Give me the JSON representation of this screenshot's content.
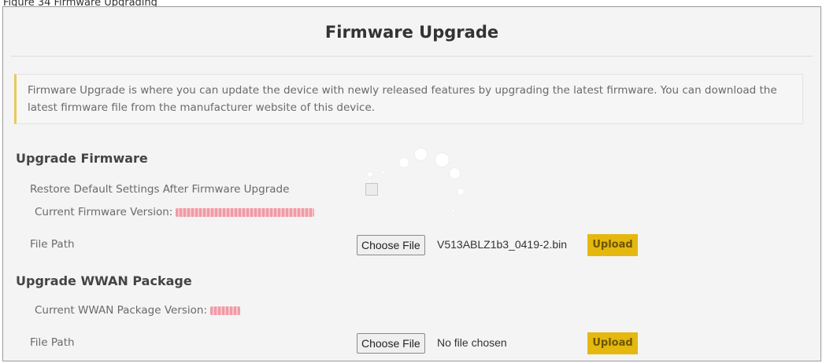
{
  "caption": "Figure 34   Firmware Upgrading",
  "page": {
    "title": "Firmware Upgrade",
    "description": "Firmware Upgrade is where you can update the device with newly released features by upgrading the latest firmware. You can download the latest firmware file from the manufacturer website of this device."
  },
  "upgrade_firmware": {
    "heading": "Upgrade Firmware",
    "restore_label": "Restore Default Settings After Firmware Upgrade",
    "restore_checked": false,
    "version_label": "Current Firmware Version:",
    "file_path_label": "File Path",
    "choose_file_label": "Choose File",
    "file_name": "V513ABLZ1b3_0419-2.bin",
    "upload_label": "Upload"
  },
  "upgrade_wwan": {
    "heading": "Upgrade WWAN Package",
    "version_label": "Current WWAN Package Version:",
    "file_path_label": "File Path",
    "choose_file_label": "Choose File",
    "file_name": "No file chosen",
    "upload_label": "Upload"
  },
  "colors": {
    "accent": "#e5b80f",
    "redacted_text": "#f09aa6"
  },
  "icons": {
    "loading": "loading-spinner-icon"
  }
}
